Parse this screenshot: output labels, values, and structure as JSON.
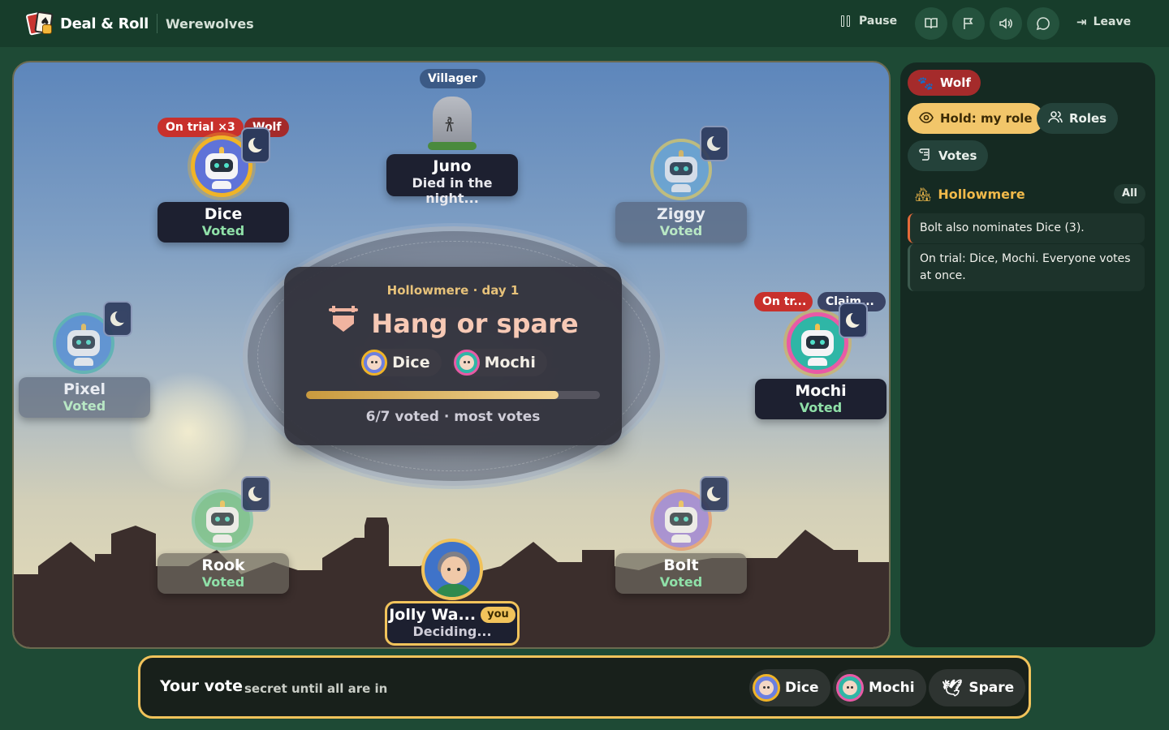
{
  "header": {
    "brand": "Deal & Roll",
    "game": "Werewolves",
    "pause_label": "Pause",
    "leave_label": "Leave"
  },
  "center": {
    "subtitle": "Hollowmere · day 1",
    "title": "Hang or spare",
    "candidates": [
      "Dice",
      "Mochi"
    ],
    "progress_fraction": 0.86,
    "status": "6/7 voted · most votes"
  },
  "dead": {
    "role_tag": "Villager",
    "name": "Juno",
    "status": "Died in the night..."
  },
  "seats": {
    "dice": {
      "name": "Dice",
      "status": "Voted",
      "tag1": "On trial ×3",
      "tag2": "Wolf"
    },
    "ziggy": {
      "name": "Ziggy",
      "status": "Voted"
    },
    "pixel": {
      "name": "Pixel",
      "status": "Voted"
    },
    "mochi": {
      "name": "Mochi",
      "status": "Voted",
      "tag1": "On tr...",
      "tag2": "Claim..."
    },
    "rook": {
      "name": "Rook",
      "status": "Voted"
    },
    "bolt": {
      "name": "Bolt",
      "status": "Voted"
    },
    "you": {
      "name": "Jolly Wa...",
      "badge": "you",
      "status": "Deciding..."
    }
  },
  "panel": {
    "role_pill": "Wolf",
    "hold_label": "Hold: my role",
    "roles_label": "Roles",
    "votes_label": "Votes",
    "log_title": "Hollowmere",
    "log_filter": "All",
    "log": [
      "Bolt also nominates Dice (3).",
      "On trial: Dice, Mochi. Everyone votes at once."
    ]
  },
  "votebar": {
    "title": "Your vote",
    "subtitle": "secret until all are in",
    "options": [
      "Dice",
      "Mochi",
      "Spare"
    ]
  },
  "colors": {
    "accent_gold": "#f1c35b",
    "wolf_red": "#a52b2b",
    "voted_green": "#8fe0a8",
    "bg_green": "#1e4a35"
  }
}
